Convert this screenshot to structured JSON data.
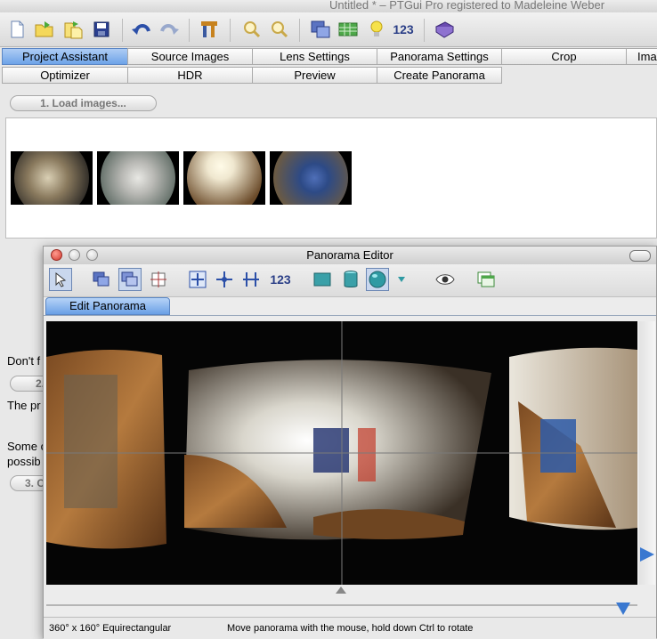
{
  "window": {
    "title": "Untitled * – PTGui Pro registered to Madeleine Weber"
  },
  "toolbar": {
    "icons": [
      "new-document-icon",
      "open-folder-icon",
      "open-recent-icon",
      "save-icon",
      "undo-icon",
      "redo-icon",
      "tools-icon",
      "zoom-in-icon",
      "zoom-out-icon",
      "panorama-editor-icon",
      "table-editor-icon",
      "lightbulb-icon",
      "numbers-icon",
      "help-book-icon"
    ],
    "numbers_label": "123"
  },
  "tabs_row1": [
    "Project Assistant",
    "Source Images",
    "Lens Settings",
    "Panorama Settings",
    "Crop",
    "Ima"
  ],
  "tabs_row2": [
    "Optimizer",
    "HDR",
    "Preview",
    "Create Panorama"
  ],
  "assistant": {
    "load_button": "1. Load images...",
    "step2_text_partial": "Don't f",
    "step2_button_partial": "2.",
    "step2_desc_partial": "The pr",
    "step3_text_line1_partial": "Some c",
    "step3_text_line2_partial": "possib",
    "step3_button_partial": "3. C"
  },
  "thumbnails": [
    {
      "name": "image-1",
      "colors": [
        "#2d2a26",
        "#8a7a5e"
      ]
    },
    {
      "name": "image-2",
      "colors": [
        "#b8b8b4",
        "#5d6a63"
      ]
    },
    {
      "name": "image-3",
      "colors": [
        "#f0e8d0",
        "#6b4b2a"
      ]
    },
    {
      "name": "image-4",
      "colors": [
        "#6a5a44",
        "#2d4a86"
      ]
    }
  ],
  "editor": {
    "title": "Panorama Editor",
    "tab": "Edit Panorama",
    "toolbar_numbers_label": "123",
    "status_projection": "360° x 160° Equirectangular",
    "status_hint": "Move panorama with the mouse, hold down Ctrl to rotate"
  },
  "colors": {
    "active_tab": "#6da3e8",
    "close_light": "#e0443a",
    "panorama_bg": "#050505"
  }
}
